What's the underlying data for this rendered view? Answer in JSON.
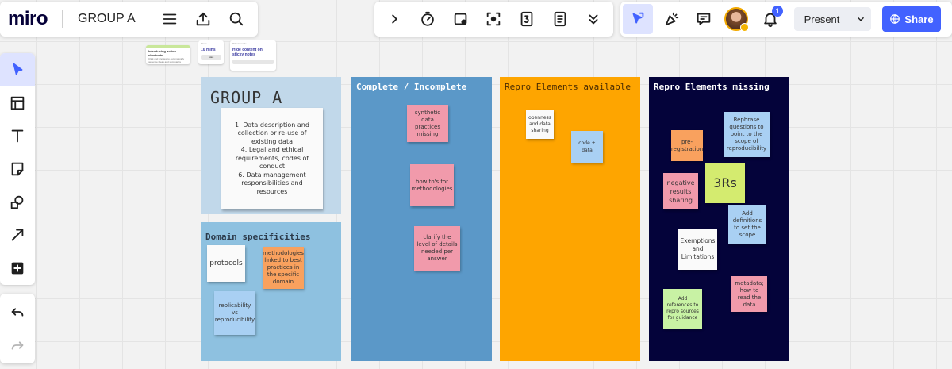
{
  "app": {
    "logo": "miro",
    "board_name": "GROUP A"
  },
  "topbar": {
    "present_label": "Present",
    "share_label": "Share",
    "notification_count": "1",
    "icons": [
      "menu-icon",
      "export-icon",
      "search-icon",
      "chevron-right-icon",
      "timer-icon",
      "video-icon",
      "frame-capture-icon",
      "counter-icon",
      "notes-icon",
      "chevron-double-down-icon",
      "cursor-arrow-icon",
      "celebrate-icon",
      "comment-icon",
      "avatar",
      "bell-icon"
    ]
  },
  "toolbar_left": {
    "tools": [
      "select",
      "templates",
      "text",
      "sticky-note",
      "shapes",
      "arrow",
      "add",
      "undo",
      "redo"
    ]
  },
  "mini_cards": {
    "card1": {
      "title": "Introducing action shortcuts",
      "body": "Click and preview to automatically generate ideas and summarize"
    },
    "card2": {
      "label": "Timer",
      "title": "10 mins",
      "button": "Start"
    },
    "card3": {
      "label": "Private mode",
      "title": "Hide content on sticky notes",
      "button": ""
    }
  },
  "frames": {
    "group_a": {
      "title": "GROUP A",
      "note": {
        "line1": "1. Data description and collection or re-use of existing data",
        "line2": "4. Legal and ethical requirements, codes of conduct",
        "line3": "6. Data management responsibilities and resources"
      }
    },
    "domain": {
      "title": "Domain specificities",
      "notes": {
        "protocols": "protocols",
        "methodologies": "methodologies linked to best practices in the specific domain",
        "replicability": "replicability vs reproducibility"
      }
    },
    "complete": {
      "title": "Complete / Incomplete",
      "notes": {
        "synthetic": "synthetic data practices missing",
        "howtos": "how to's for methodologies",
        "clarify": "clarify the level of details needed per answer"
      }
    },
    "repro_available": {
      "title": "Repro Elements available",
      "notes": {
        "openness": "openness and data sharing",
        "code": "code + data"
      }
    },
    "repro_missing": {
      "title": "Repro Elements missing",
      "notes": {
        "prereg": "pre-registration",
        "rephrase": "Rephrase questions to point to the scope of reproducibility",
        "negative": "negative results sharing",
        "threers": "3Rs",
        "definitions": "Add definitions to set the scope",
        "exemptions": "Exemptions and Limitations",
        "metadata": "metadata; how to read the data",
        "references": "Add references to repro sources for guidance"
      }
    }
  },
  "colors": {
    "accent": "#4262ff",
    "group_a_frame": "#c1d8ea",
    "domain_frame": "#8ec1e0",
    "complete_frame": "#5b98c8",
    "available_frame": "#fea500",
    "missing_frame": "#04033a"
  }
}
